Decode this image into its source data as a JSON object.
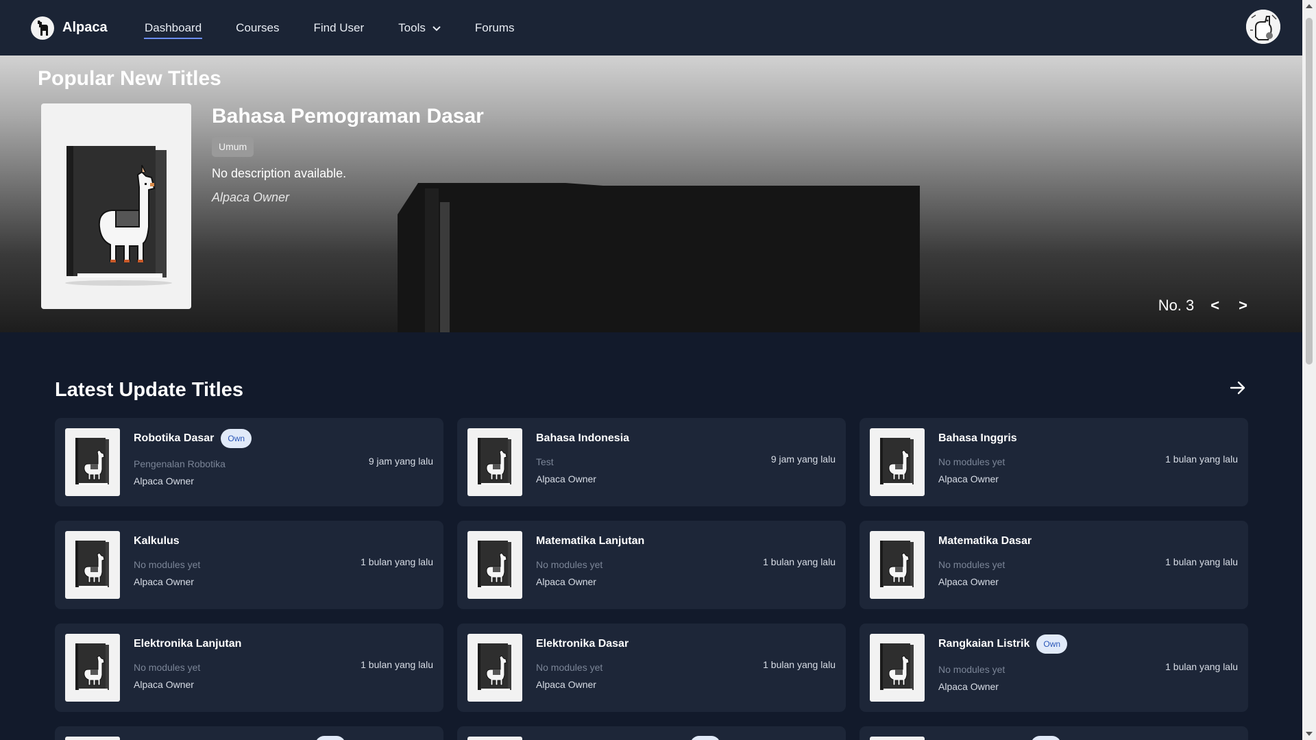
{
  "app": {
    "name": "Alpaca"
  },
  "nav": {
    "items": [
      {
        "label": "Dashboard",
        "active": true
      },
      {
        "label": "Courses"
      },
      {
        "label": "Find User"
      },
      {
        "label": "Tools",
        "dropdown": true
      },
      {
        "label": "Forums"
      }
    ]
  },
  "hero": {
    "heading": "Popular New Titles",
    "title": "Bahasa Pemograman Dasar",
    "tag": "Umum",
    "description": "No description available.",
    "author": "Alpaca Owner",
    "pager_label": "No. 3",
    "prev": "<",
    "next": ">"
  },
  "latest": {
    "heading": "Latest Update Titles",
    "cards": [
      {
        "title": "Robotika Dasar",
        "badge": "Own",
        "subtitle": "Pengenalan Robotika",
        "author": "Alpaca Owner",
        "time": "9 jam yang lalu"
      },
      {
        "title": "Bahasa Indonesia",
        "subtitle": "Test",
        "author": "Alpaca Owner",
        "time": "9 jam yang lalu"
      },
      {
        "title": "Bahasa Inggris",
        "subtitle": "No modules yet",
        "author": "Alpaca Owner",
        "time": "1 bulan yang lalu"
      },
      {
        "title": "Kalkulus",
        "subtitle": "No modules yet",
        "author": "Alpaca Owner",
        "time": "1 bulan yang lalu"
      },
      {
        "title": "Matematika Lanjutan",
        "subtitle": "No modules yet",
        "author": "Alpaca Owner",
        "time": "1 bulan yang lalu"
      },
      {
        "title": "Matematika Dasar",
        "subtitle": "No modules yet",
        "author": "Alpaca Owner",
        "time": "1 bulan yang lalu"
      },
      {
        "title": "Elektronika Lanjutan",
        "subtitle": "No modules yet",
        "author": "Alpaca Owner",
        "time": "1 bulan yang lalu"
      },
      {
        "title": "Elektronika Dasar",
        "subtitle": "No modules yet",
        "author": "Alpaca Owner",
        "time": "1 bulan yang lalu"
      },
      {
        "title": "Rangkaian Listrik",
        "badge": "Own",
        "subtitle": "No modules yet",
        "author": "Alpaca Owner",
        "time": "1 bulan yang lalu"
      }
    ]
  },
  "colors": {
    "page_bg": "#121a2b",
    "nav_bg": "#1b2435",
    "card_bg": "#1d2638",
    "accent": "#6c8ef5",
    "badge_bg": "#e1eaf9",
    "badge_text": "#2a57b8"
  },
  "icons": {
    "logo": "alpaca-logo-icon",
    "tools_dropdown": "chevron-down-icon",
    "see_more": "arrow-right-icon",
    "thumbnail": "alpaca-book-icon"
  }
}
